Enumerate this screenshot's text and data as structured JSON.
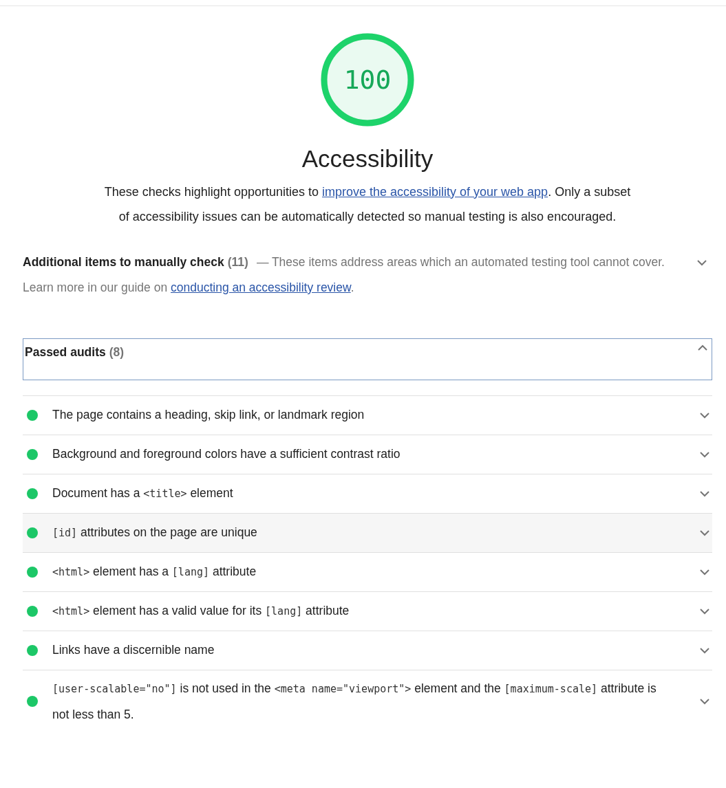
{
  "score": {
    "value": "100"
  },
  "category": {
    "title": "Accessibility",
    "description": [
      {
        "kind": "text",
        "text": "These checks highlight opportunities to "
      },
      {
        "kind": "link",
        "text": "improve the accessibility of your web app"
      },
      {
        "kind": "text",
        "text": ". Only a subset of accessibility issues can be automatically detected so manual testing is also encouraged."
      }
    ]
  },
  "manual_group": {
    "title": "Additional items to manually check",
    "count": "(11)",
    "expanded": false,
    "description": [
      {
        "kind": "text",
        "text": "— These items address areas which an automated testing tool cannot cover. Learn more in our guide on "
      },
      {
        "kind": "link",
        "text": "conducting an accessibility review"
      },
      {
        "kind": "text",
        "text": "."
      }
    ]
  },
  "passed_group": {
    "title": "Passed audits",
    "count": "(8)",
    "expanded": true,
    "audits": [
      {
        "hovered": false,
        "expanded": false,
        "parts": [
          {
            "kind": "text",
            "text": "The page contains a heading, skip link, or landmark region"
          }
        ]
      },
      {
        "hovered": false,
        "expanded": false,
        "parts": [
          {
            "kind": "text",
            "text": "Background and foreground colors have a sufficient contrast ratio"
          }
        ]
      },
      {
        "hovered": false,
        "expanded": false,
        "parts": [
          {
            "kind": "text",
            "text": "Document has a "
          },
          {
            "kind": "code",
            "text": "<title>"
          },
          {
            "kind": "text",
            "text": " element"
          }
        ]
      },
      {
        "hovered": true,
        "expanded": false,
        "parts": [
          {
            "kind": "code",
            "text": "[id]"
          },
          {
            "kind": "text",
            "text": " attributes on the page are unique"
          }
        ]
      },
      {
        "hovered": false,
        "expanded": false,
        "parts": [
          {
            "kind": "code",
            "text": "<html>"
          },
          {
            "kind": "text",
            "text": " element has a "
          },
          {
            "kind": "code",
            "text": "[lang]"
          },
          {
            "kind": "text",
            "text": " attribute"
          }
        ]
      },
      {
        "hovered": false,
        "expanded": false,
        "parts": [
          {
            "kind": "code",
            "text": "<html>"
          },
          {
            "kind": "text",
            "text": " element has a valid value for its "
          },
          {
            "kind": "code",
            "text": "[lang]"
          },
          {
            "kind": "text",
            "text": " attribute"
          }
        ]
      },
      {
        "hovered": false,
        "expanded": false,
        "parts": [
          {
            "kind": "text",
            "text": "Links have a discernible name"
          }
        ]
      },
      {
        "hovered": false,
        "expanded": false,
        "parts": [
          {
            "kind": "code",
            "text": "[user-scalable=\"no\"]"
          },
          {
            "kind": "text",
            "text": " is not used in the "
          },
          {
            "kind": "code",
            "text": "<meta name=\"viewport\">"
          },
          {
            "kind": "text",
            "text": " element and the "
          },
          {
            "kind": "code",
            "text": "[maximum-scale]"
          },
          {
            "kind": "text",
            "text": " attribute is not less than 5."
          }
        ]
      }
    ]
  }
}
